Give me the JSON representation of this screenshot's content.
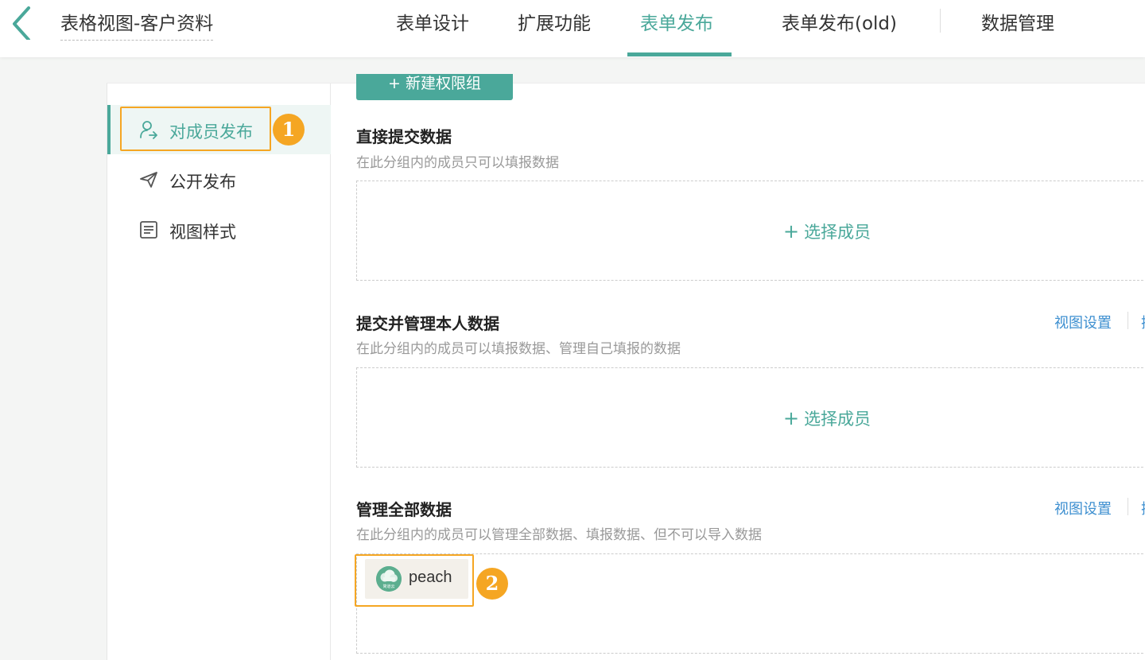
{
  "header": {
    "title": "表格视图-客户资料",
    "tabs": [
      {
        "label": "表单设计"
      },
      {
        "label": "扩展功能"
      },
      {
        "label": "表单发布"
      },
      {
        "label": "表单发布(old)"
      },
      {
        "label": "数据管理"
      }
    ],
    "active_tab": "表单发布"
  },
  "sidebar": {
    "items": [
      {
        "label": "对成员发布",
        "icon": "user-share-icon"
      },
      {
        "label": "公开发布",
        "icon": "paper-plane-icon"
      },
      {
        "label": "视图样式",
        "icon": "list-document-icon"
      }
    ],
    "active_item": "对成员发布"
  },
  "annotations": {
    "badge1": "1",
    "badge2": "2",
    "color": "#f5a623"
  },
  "content": {
    "new_group_button": "+ 新建权限组",
    "sections": [
      {
        "title": "直接提交数据",
        "description": "在此分组内的成员只可以填报数据",
        "add_member": "选择成员"
      },
      {
        "title": "提交并管理本人数据",
        "description": "在此分组内的成员可以填报数据、管理自己填报的数据",
        "link": "视图设置",
        "add_member": "选择成员"
      },
      {
        "title": "管理全部数据",
        "description": "在此分组内的成员可以管理全部数据、填报数据、但不可以导入数据",
        "link": "视图设置",
        "members": [
          {
            "name": "peach",
            "avatar_text": "简道云"
          }
        ]
      }
    ],
    "cut_link_char": "操"
  },
  "colors": {
    "accent": "#4aa89a",
    "link": "#3d8fd0",
    "highlight": "#f5a623"
  }
}
